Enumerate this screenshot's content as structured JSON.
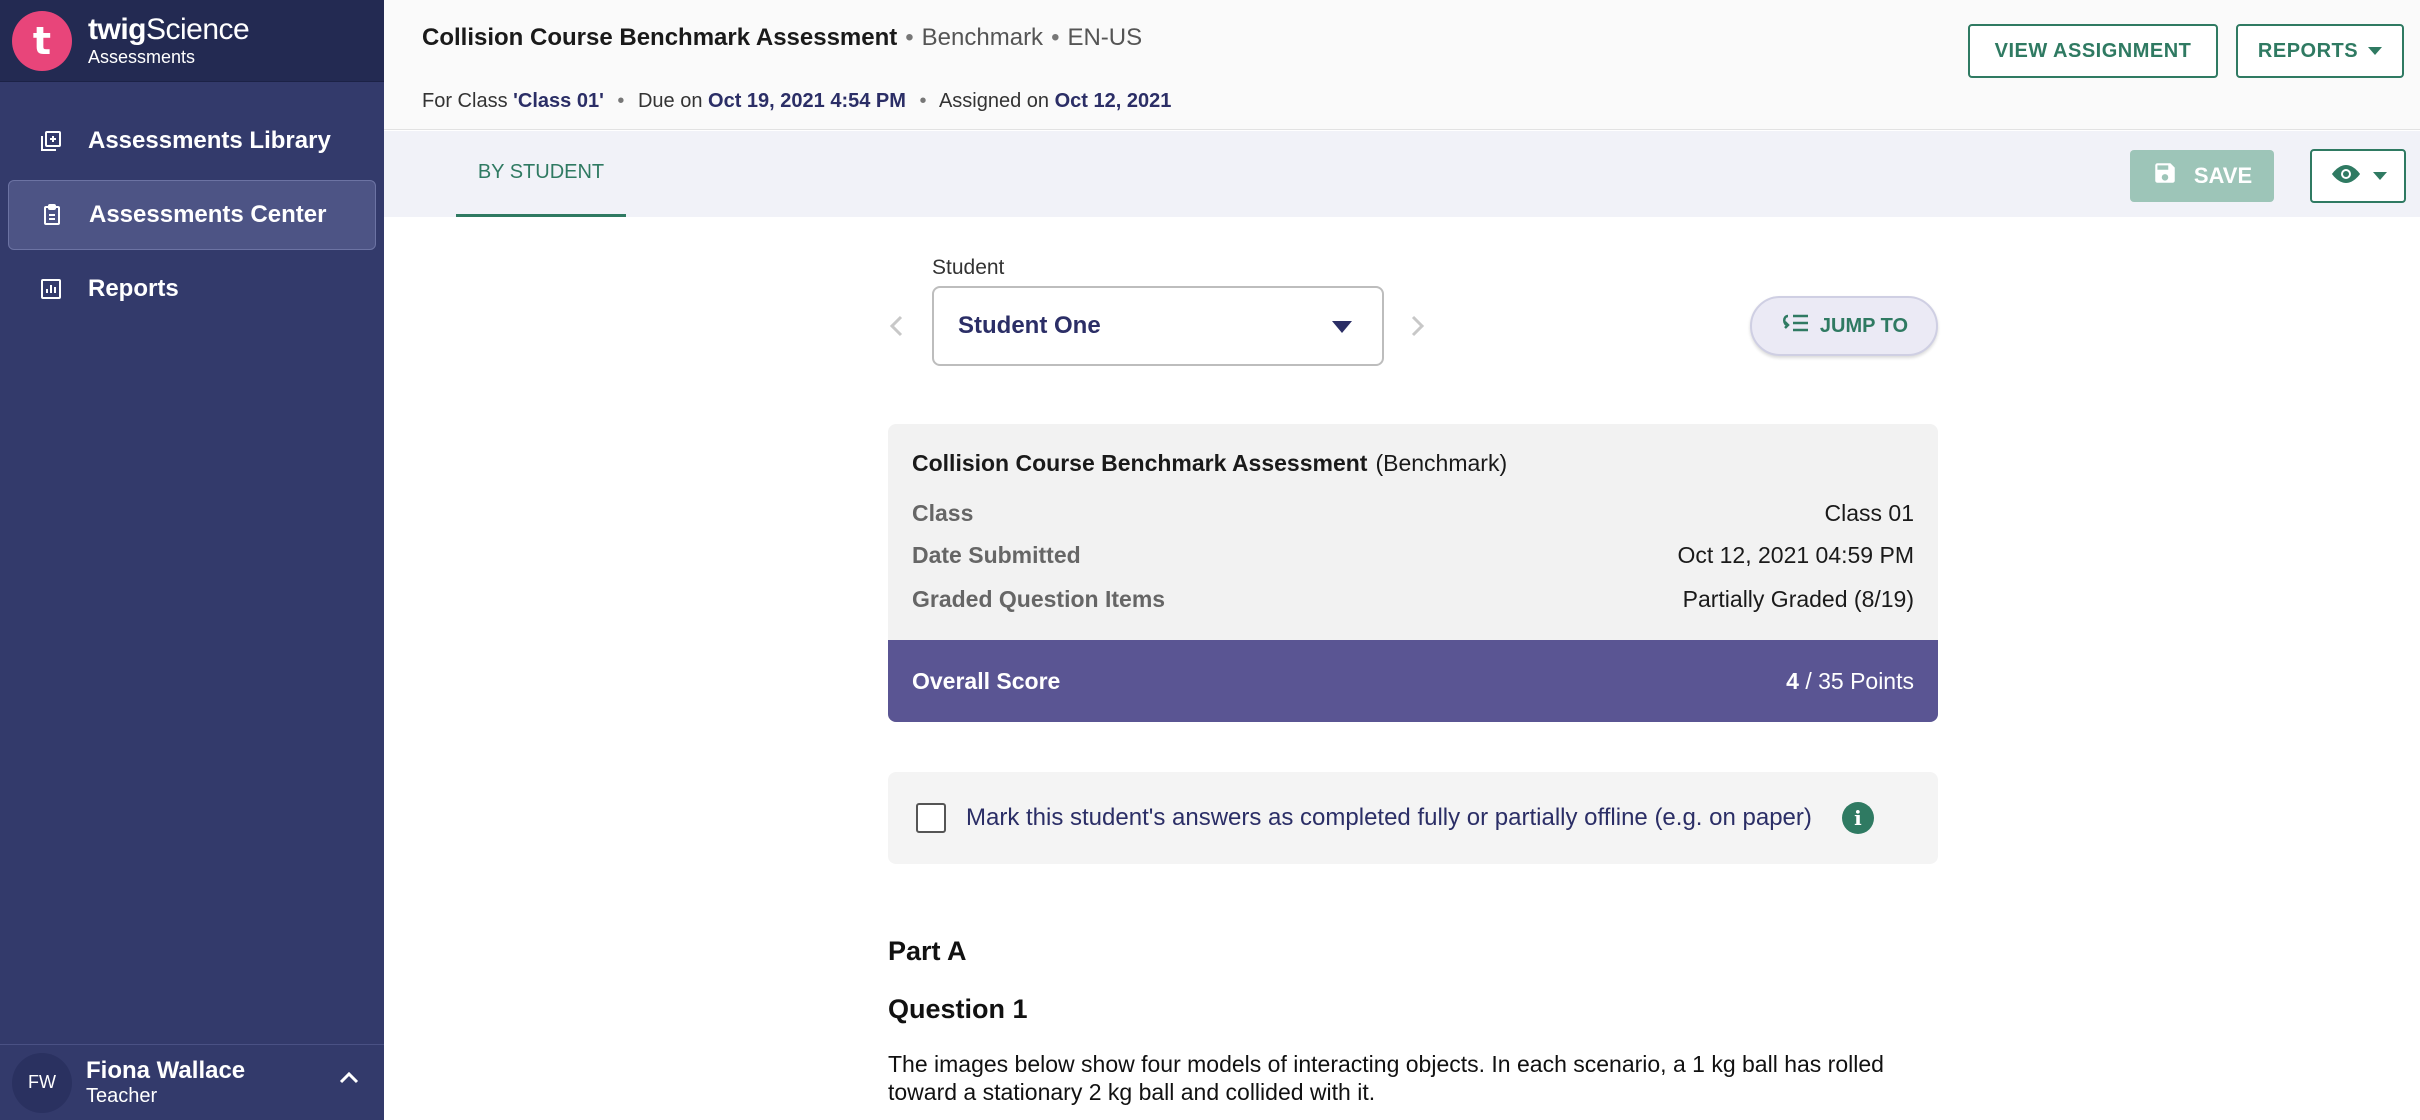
{
  "sidebar": {
    "brand_name": "twig",
    "brand_name_2": "Science",
    "brand_sub": "Assessments",
    "items": [
      {
        "label": "Assessments Library"
      },
      {
        "label": "Assessments Center"
      },
      {
        "label": "Reports"
      }
    ],
    "user": {
      "initials": "FW",
      "name": "Fiona Wallace",
      "role": "Teacher"
    }
  },
  "header": {
    "title": "Collision Course Benchmark Assessment",
    "type": "Benchmark",
    "locale": "EN-US",
    "for_class_label": "For Class",
    "class_name": "'Class 01'",
    "due_label": "Due on",
    "due_date": "Oct 19, 2021 4:54 PM",
    "assigned_label": "Assigned on",
    "assigned_date": "Oct 12, 2021",
    "view_assignment_label": "VIEW ASSIGNMENT",
    "reports_label": "REPORTS"
  },
  "tabs": {
    "by_student": "BY STUDENT",
    "save_label": "SAVE"
  },
  "student": {
    "label": "Student",
    "selected": "Student One",
    "jump_to_label": "JUMP TO"
  },
  "summary": {
    "title": "Collision Course Benchmark Assessment",
    "type": "(Benchmark)",
    "class_label": "Class",
    "class_value": "Class 01",
    "date_label": "Date Submitted",
    "date_value": "Oct 12, 2021 04:59 PM",
    "graded_label": "Graded Question Items",
    "graded_value": "Partially Graded (8/19)",
    "score_label": "Overall Score",
    "score_value": "4",
    "score_total": "/ 35 Points"
  },
  "offline": {
    "label": "Mark this student's answers as completed fully or partially offline (e.g. on paper)",
    "checked": false
  },
  "content": {
    "part": "Part A",
    "question": "Question 1",
    "text": "The images below show four models of interacting objects. In each scenario, a 1 kg ball has rolled toward a stationary 2 kg ball and collided with it."
  },
  "colors": {
    "sidebar": "#333a6b",
    "accent": "#2f7a62",
    "score_bar": "#5a5593",
    "logo": "#e8457a"
  }
}
